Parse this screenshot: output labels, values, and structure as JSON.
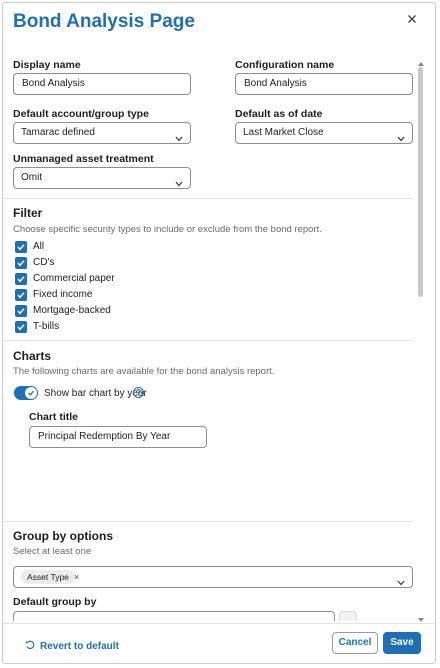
{
  "dialog": {
    "title": "Bond Analysis Page"
  },
  "general": {
    "display_name_label": "Display name",
    "display_name_value": "Bond Analysis",
    "configuration_name_label": "Configuration name",
    "configuration_name_value": "Bond Analysis",
    "account_type_label": "Default account/group type",
    "account_type_value": "Tamarac defined",
    "as_of_date_label": "Default as of date",
    "as_of_date_value": "Last Market Close",
    "unmanaged_label": "Unmanaged asset treatment",
    "unmanaged_value": "Omit"
  },
  "filter": {
    "title": "Filter",
    "description": "Choose specific security types to include or exclude from the bond report.",
    "items": [
      {
        "label": "All",
        "checked": true
      },
      {
        "label": "CD's",
        "checked": true
      },
      {
        "label": "Commercial paper",
        "checked": true
      },
      {
        "label": "Fixed income",
        "checked": true
      },
      {
        "label": "Mortgage-backed",
        "checked": true
      },
      {
        "label": "T-bills",
        "checked": true
      }
    ]
  },
  "charts": {
    "title": "Charts",
    "description": "The following charts are available for the bond analysis report.",
    "toggle_label": "Show bar chart by year",
    "toggle_on": true,
    "help_glyph": "?",
    "chart_title_label": "Chart title",
    "chart_title_value": "Principal Redemption By Year"
  },
  "group_by": {
    "title": "Group by options",
    "description": "Select at least one",
    "chip_label": "Asset Type",
    "chip_remove": "×",
    "default_group_label": "Default group by"
  },
  "footer": {
    "revert_label": "Revert to default",
    "cancel_label": "Cancel",
    "save_label": "Save"
  },
  "colors": {
    "accent": "#1f6fb5",
    "border": "#8f8f8f"
  }
}
